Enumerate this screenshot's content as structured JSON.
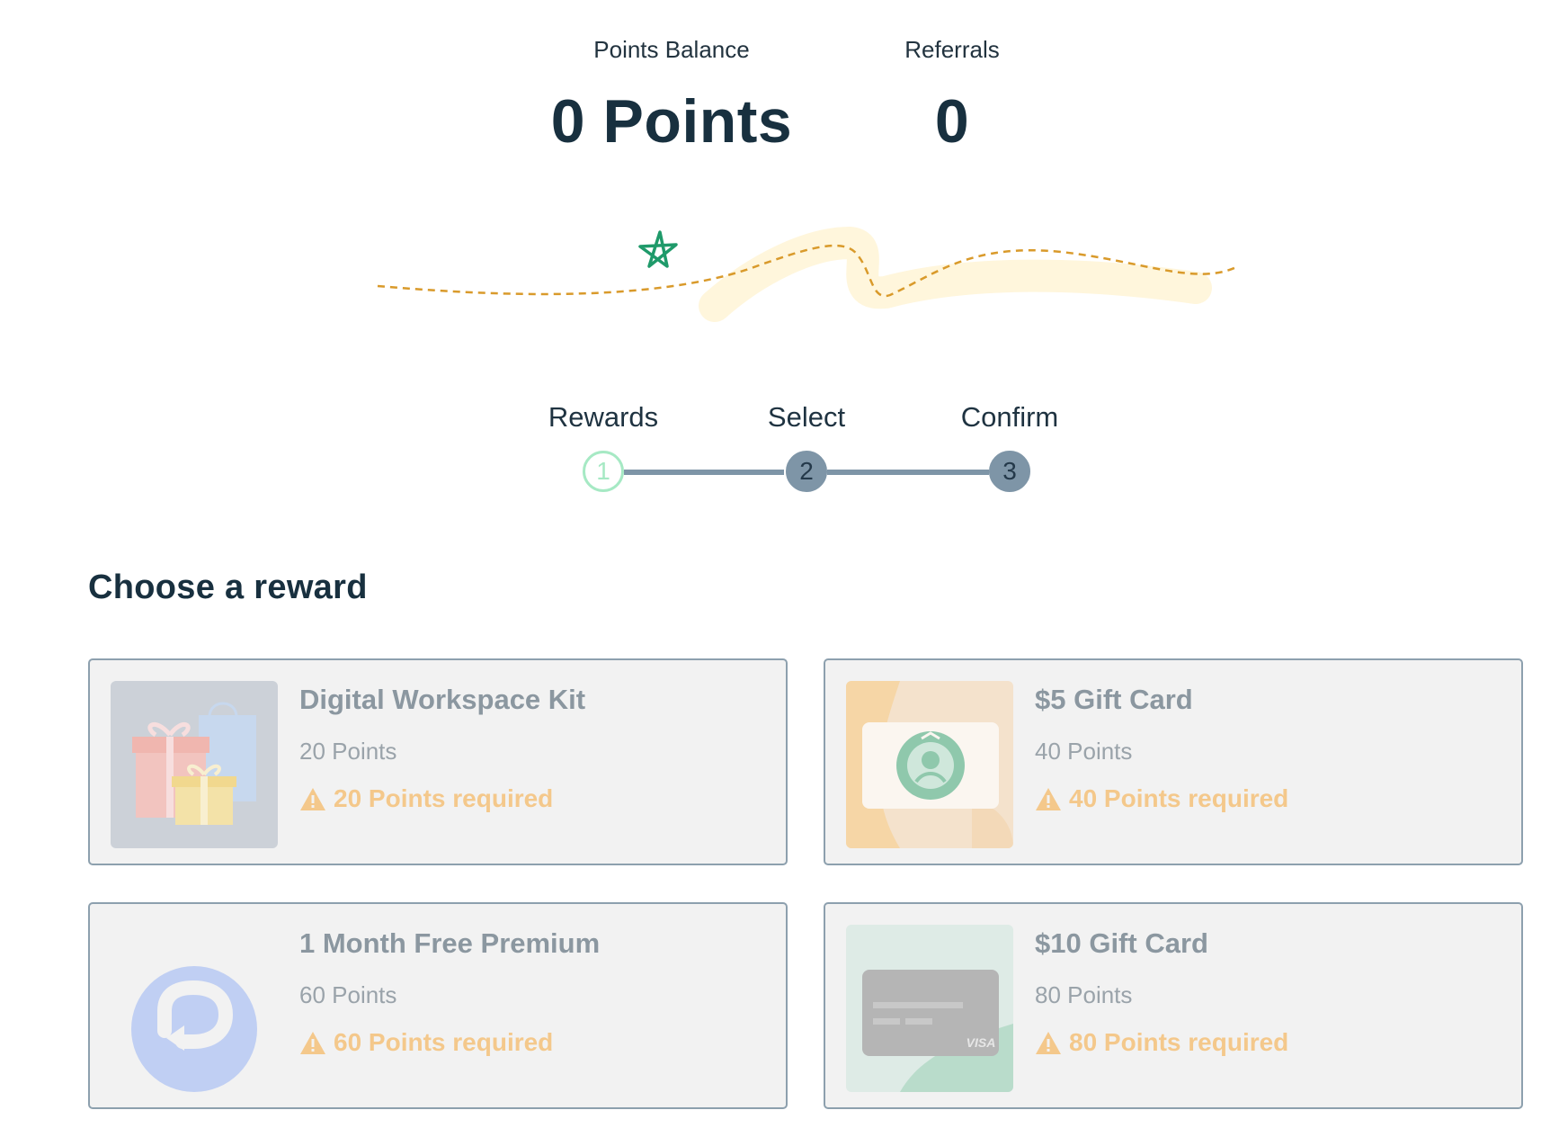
{
  "stats": {
    "points_balance_label": "Points Balance",
    "points_balance_value": "0 Points",
    "referrals_label": "Referrals",
    "referrals_value": "0"
  },
  "steps": [
    {
      "number": "1",
      "label": "Rewards",
      "state": "active"
    },
    {
      "number": "2",
      "label": "Select",
      "state": "pending"
    },
    {
      "number": "3",
      "label": "Confirm",
      "state": "pending"
    }
  ],
  "section": {
    "title": "Choose a reward"
  },
  "rewards": [
    {
      "title": "Digital Workspace Kit",
      "points": "20 Points",
      "requirement": "20 Points required",
      "icon": "gift-boxes-icon"
    },
    {
      "title": "$5 Gift Card",
      "points": "40 Points",
      "requirement": "40 Points required",
      "icon": "starbucks-card-icon"
    },
    {
      "title": "1 Month Free Premium",
      "points": "60 Points",
      "requirement": "60 Points required",
      "icon": "premium-logo-icon"
    },
    {
      "title": "$10 Gift Card",
      "points": "80 Points",
      "requirement": "80 Points required",
      "icon": "visa-card-icon"
    }
  ],
  "colors": {
    "primary_text": "#18303f",
    "step_active": "#a6e9c4",
    "step_pending": "#7e95a7",
    "warning": "#f4c88b",
    "card_border": "#8da0ae",
    "star": "#1f9a6a",
    "path_dash": "#d99a2b"
  }
}
